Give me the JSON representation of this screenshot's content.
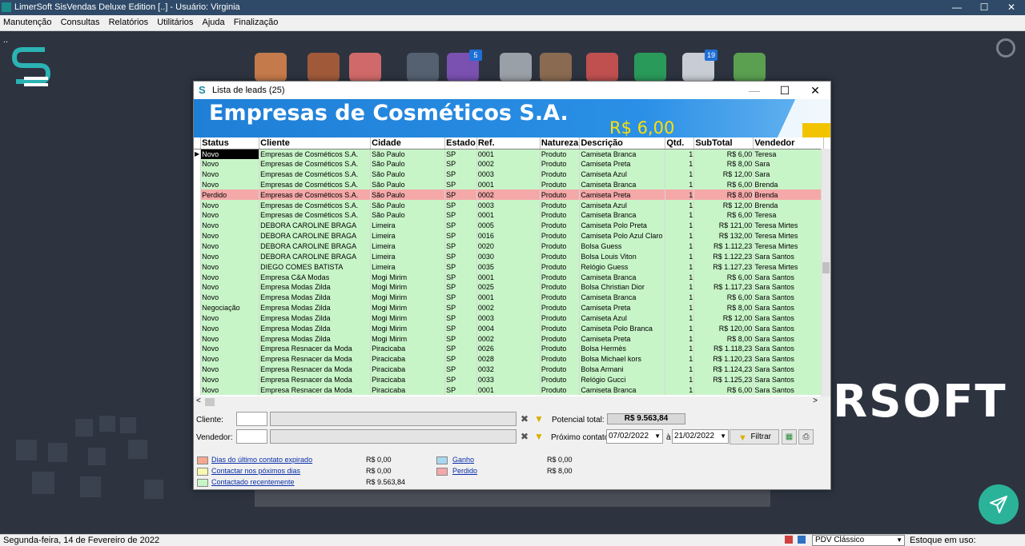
{
  "window": {
    "title": "LimerSoft SisVendas Deluxe Edition [..] - Usuário: Virginia",
    "btn_min": "—",
    "btn_max": "☐",
    "btn_close": "✕"
  },
  "menu": [
    "Manutenção",
    "Consultas",
    "Relatórios",
    "Utilitários",
    "Ajuda",
    "Finalização"
  ],
  "desktop": {
    "dots": "..",
    "brand_text": "RSOFT",
    "badges": {
      "cart": "5",
      "calendar": "19"
    }
  },
  "dialog": {
    "title": "Lista de leads (25)",
    "btn_min": "—",
    "btn_max": "☐",
    "btn_close": "✕",
    "company": "Empresas de Cosméticos S.A.",
    "price": "R$ 6,00"
  },
  "grid": {
    "columns": [
      "Status",
      "Cliente",
      "Cidade",
      "Estado",
      "Ref.",
      "Natureza",
      "Descrição",
      "Qtd.",
      "SubTotal",
      "Vendedor"
    ],
    "rows": [
      [
        "Novo",
        "Empresas de Cosméticos S.A.",
        "São Paulo",
        "SP",
        "0001",
        "Produto",
        "Camiseta Branca",
        "1",
        "R$ 6,00",
        "Teresa"
      ],
      [
        "Novo",
        "Empresas de Cosméticos S.A.",
        "São Paulo",
        "SP",
        "0002",
        "Produto",
        "Camiseta Preta",
        "1",
        "R$ 8,00",
        "Sara"
      ],
      [
        "Novo",
        "Empresas de Cosméticos S.A.",
        "São Paulo",
        "SP",
        "0003",
        "Produto",
        "Camiseta Azul",
        "1",
        "R$ 12,00",
        "Sara"
      ],
      [
        "Novo",
        "Empresas de Cosméticos S.A.",
        "São Paulo",
        "SP",
        "0001",
        "Produto",
        "Camiseta Branca",
        "1",
        "R$ 6,00",
        "Brenda"
      ],
      [
        "Perdido",
        "Empresas de Cosméticos S.A.",
        "São Paulo",
        "SP",
        "0002",
        "Produto",
        "Camiseta Preta",
        "1",
        "R$ 8,00",
        "Brenda"
      ],
      [
        "Novo",
        "Empresas de Cosméticos S.A.",
        "São Paulo",
        "SP",
        "0003",
        "Produto",
        "Camiseta Azul",
        "1",
        "R$ 12,00",
        "Brenda"
      ],
      [
        "Novo",
        "Empresas de Cosméticos S.A.",
        "São Paulo",
        "SP",
        "0001",
        "Produto",
        "Camiseta Branca",
        "1",
        "R$ 6,00",
        "Teresa"
      ],
      [
        "Novo",
        "DEBORA CAROLINE BRAGA",
        "Limeira",
        "SP",
        "0005",
        "Produto",
        "Camiseta Polo Preta",
        "1",
        "R$ 121,00",
        "Teresa Mirtes"
      ],
      [
        "Novo",
        "DEBORA CAROLINE BRAGA",
        "Limeira",
        "SP",
        "0016",
        "Produto",
        "Camiseta Polo Azul Claro",
        "1",
        "R$ 132,00",
        "Teresa Mirtes"
      ],
      [
        "Novo",
        "DEBORA CAROLINE BRAGA",
        "Limeira",
        "SP",
        "0020",
        "Produto",
        "Bolsa Guess",
        "1",
        "R$ 1.112,23",
        "Teresa Mirtes"
      ],
      [
        "Novo",
        "DEBORA CAROLINE BRAGA",
        "Limeira",
        "SP",
        "0030",
        "Produto",
        "Bolsa Louis Viton",
        "1",
        "R$ 1.122,23",
        "Sara Santos"
      ],
      [
        "Novo",
        "DIEGO COMES BATISTA",
        "Limeira",
        "SP",
        "0035",
        "Produto",
        "Relógio Guess",
        "1",
        "R$ 1.127,23",
        "Teresa Mirtes"
      ],
      [
        "Novo",
        "Empresa C&A Modas",
        "Mogi Mirim",
        "SP",
        "0001",
        "Produto",
        "Camiseta Branca",
        "1",
        "R$ 6,00",
        "Sara Santos"
      ],
      [
        "Novo",
        "Empresa Modas Zilda",
        "Mogi Mirim",
        "SP",
        "0025",
        "Produto",
        "Bolsa Christian Dior",
        "1",
        "R$ 1.117,23",
        "Sara Santos"
      ],
      [
        "Novo",
        "Empresa Modas Zilda",
        "Mogi Mirim",
        "SP",
        "0001",
        "Produto",
        "Camiseta Branca",
        "1",
        "R$ 6,00",
        "Sara Santos"
      ],
      [
        "Negociação",
        "Empresa Modas Zilda",
        "Mogi Mirim",
        "SP",
        "0002",
        "Produto",
        "Camiseta Preta",
        "1",
        "R$ 8,00",
        "Sara Santos"
      ],
      [
        "Novo",
        "Empresa Modas Zilda",
        "Mogi Mirim",
        "SP",
        "0003",
        "Produto",
        "Camiseta Azul",
        "1",
        "R$ 12,00",
        "Sara Santos"
      ],
      [
        "Novo",
        "Empresa Modas Zilda",
        "Mogi Mirim",
        "SP",
        "0004",
        "Produto",
        "Camiseta Polo Branca",
        "1",
        "R$ 120,00",
        "Sara Santos"
      ],
      [
        "Novo",
        "Empresa Modas Zilda",
        "Mogi Mirim",
        "SP",
        "0002",
        "Produto",
        "Camiseta Preta",
        "1",
        "R$ 8,00",
        "Sara Santos"
      ],
      [
        "Novo",
        "Empresa Resnacer da Moda",
        "Piracicaba",
        "SP",
        "0026",
        "Produto",
        "Bolsa Hermès",
        "1",
        "R$ 1.118,23",
        "Sara Santos"
      ],
      [
        "Novo",
        "Empresa Resnacer da Moda",
        "Piracicaba",
        "SP",
        "0028",
        "Produto",
        "Bolsa Michael kors",
        "1",
        "R$ 1.120,23",
        "Sara Santos"
      ],
      [
        "Novo",
        "Empresa Resnacer da Moda",
        "Piracicaba",
        "SP",
        "0032",
        "Produto",
        "Bolsa Armani",
        "1",
        "R$ 1.124,23",
        "Sara Santos"
      ],
      [
        "Novo",
        "Empresa Resnacer da Moda",
        "Piracicaba",
        "SP",
        "0033",
        "Produto",
        "Relógio Gucci",
        "1",
        "R$ 1.125,23",
        "Sara Santos"
      ],
      [
        "Novo",
        "Empresa Resnacer da Moda",
        "Piracicaba",
        "SP",
        "0001",
        "Produto",
        "Camiseta Branca",
        "1",
        "R$ 6,00",
        "Sara Santos"
      ]
    ]
  },
  "filters": {
    "cliente_label": "Cliente:",
    "vendedor_label": "Vendedor:",
    "potencial_label": "Potencial total:",
    "potencial_value": "R$ 9.563,84",
    "proximo_label": "Próximo contato:",
    "date_from": "07/02/2022",
    "date_sep": "à",
    "date_to": "21/02/2022",
    "filtrar_label": "Filtrar"
  },
  "legend": {
    "expirado": {
      "label": "Dias do último contato expirado",
      "value": "R$ 0,00",
      "color": "#f5a890"
    },
    "proximos": {
      "label": "Contactar nos póximos dias",
      "value": "R$ 0,00",
      "color": "#f8f8b0"
    },
    "recente": {
      "label": "Contactado recentemente",
      "value": "R$ 9.563,84",
      "color": "#c8f5c8"
    },
    "ganho": {
      "label": "Ganho",
      "value": "R$ 0,00",
      "color": "#a8d8f0"
    },
    "perdido": {
      "label": "Perdido",
      "value": "R$ 8,00",
      "color": "#f5a8a8"
    }
  },
  "statusbar": {
    "date": "Segunda-feira, 14 de Fevereiro de 2022",
    "pdv": "PDV Clássico",
    "estoque": "Estoque em uso: DB_Estoque"
  }
}
